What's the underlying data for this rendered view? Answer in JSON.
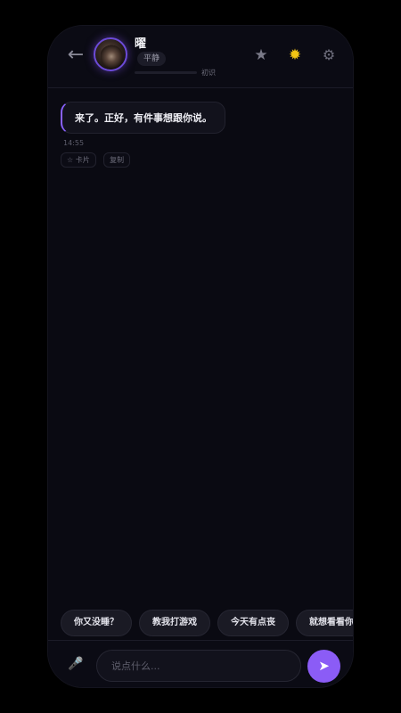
{
  "header": {
    "back_icon": "←",
    "name": "曜",
    "mood": "平静",
    "affinity_label": "初识",
    "affinity_progress": 0,
    "star_icon": "★",
    "theme_icon": "✹",
    "settings_icon": "⚙"
  },
  "messages": [
    {
      "text": "来了。正好，有件事想跟你说。",
      "time": "14:55",
      "actions": {
        "card": "☆ 卡片",
        "copy": "复制"
      }
    }
  ],
  "suggestions": [
    "你又没睡？",
    "教我打游戏",
    "今天有点丧",
    "就想看看你"
  ],
  "input": {
    "mic_icon": "🎤",
    "placeholder": "说点什么...",
    "value": "",
    "send_icon": "➤"
  },
  "colors": {
    "accent": "#8b5cf6",
    "background": "#0a0a12",
    "sun": "#f2c514"
  }
}
